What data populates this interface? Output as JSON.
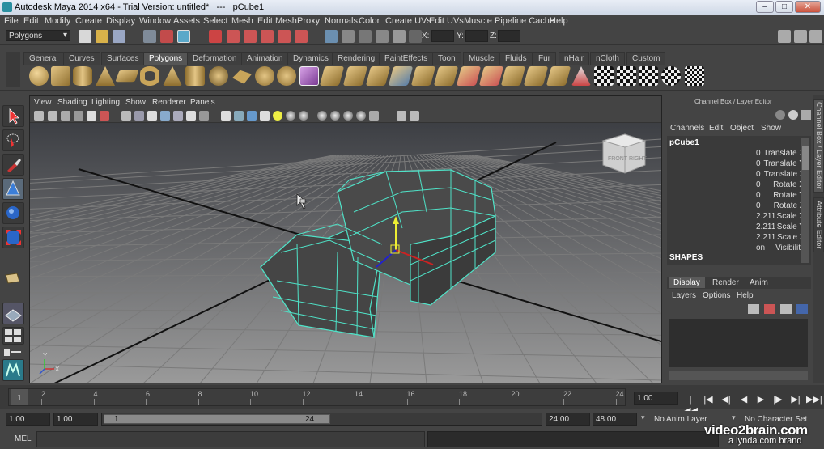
{
  "window": {
    "title": "Autodesk Maya 2014 x64 - Trial Version: untitled*   ---   pCube1",
    "controls": [
      "–",
      "□",
      "✕"
    ]
  },
  "menubar": [
    "File",
    "Edit",
    "Modify",
    "Create",
    "Display",
    "Window",
    "Assets",
    "Select",
    "Mesh",
    "Edit Mesh",
    "Proxy",
    "Normals",
    "Color",
    "Create UVs",
    "Edit UVs",
    "Muscle",
    "Pipeline Cache",
    "Help"
  ],
  "statusline": {
    "menuset": "Polygons",
    "x_label": "X:",
    "y_label": "Y:",
    "z_label": "Z:"
  },
  "shelf": {
    "tabs": [
      "General",
      "Curves",
      "Surfaces",
      "Polygons",
      "Deformation",
      "Animation",
      "Dynamics",
      "Rendering",
      "PaintEffects",
      "Toon",
      "Muscle",
      "Fluids",
      "Fur",
      "nHair",
      "nCloth",
      "Custom"
    ],
    "active_tab": "Polygons"
  },
  "viewport": {
    "menu": [
      "View",
      "Shading",
      "Lighting",
      "Show",
      "Renderer",
      "Panels"
    ],
    "viewcube_front": "FRONT",
    "viewcube_right": "RIGHT",
    "axis_x": "X",
    "axis_y": "Y"
  },
  "channelbox": {
    "header": "Channel Box / Layer Editor",
    "menu": [
      "Channels",
      "Edit",
      "Object",
      "Show"
    ],
    "object_name": "pCube1",
    "attributes": [
      {
        "name": "Translate X",
        "value": "0"
      },
      {
        "name": "Translate Y",
        "value": "0"
      },
      {
        "name": "Translate Z",
        "value": "0"
      },
      {
        "name": "Rotate X",
        "value": "0"
      },
      {
        "name": "Rotate Y",
        "value": "0"
      },
      {
        "name": "Rotate Z",
        "value": "0"
      },
      {
        "name": "Scale X",
        "value": "2.211"
      },
      {
        "name": "Scale Y",
        "value": "2.211"
      },
      {
        "name": "Scale Z",
        "value": "2.211"
      },
      {
        "name": "Visibility",
        "value": "on"
      }
    ],
    "shapes_label": "SHAPES",
    "layer_tabs": [
      "Display",
      "Render",
      "Anim"
    ],
    "active_layer_tab": "Display",
    "layer_menu": [
      "Layers",
      "Options",
      "Help"
    ]
  },
  "sidetabs": {
    "channel_box": "Channel Box / Layer Editor",
    "attribute_editor": "Attribute Editor"
  },
  "timeslider": {
    "ticks": [
      "2",
      "4",
      "6",
      "8",
      "10",
      "12",
      "14",
      "16",
      "18",
      "20",
      "22",
      "24"
    ],
    "current_frame_marker": "1",
    "current_time": "1.00"
  },
  "rangeslider": {
    "start_time": "1.00",
    "playback_start": "1.00",
    "range_start": "1",
    "range_end": "24",
    "playback_end": "24.00",
    "end_time": "48.00",
    "anim_layer": "No Anim Layer",
    "character_set": "No Character Set"
  },
  "cmdline": {
    "label": "MEL"
  },
  "watermark": {
    "brand": "video2brain.com",
    "sub": "a lynda.com brand"
  },
  "colors": {
    "wireframe": "#4fe3c8",
    "grid": "#7a7a7a",
    "viewport_top": "#3d3f44",
    "viewport_bottom": "#9a9a9a"
  }
}
